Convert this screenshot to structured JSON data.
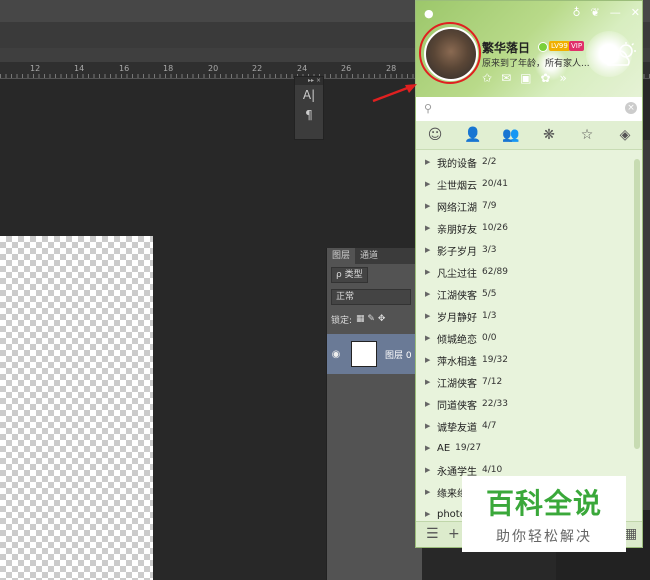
{
  "ruler": {
    "ticks": [
      "12",
      "14",
      "16",
      "18",
      "20",
      "22",
      "24",
      "26",
      "28"
    ]
  },
  "tool_panel": {
    "header": "▸▸ ×",
    "tools": [
      "A|",
      "¶"
    ]
  },
  "layers_panel": {
    "tabs": [
      "图层",
      "通道"
    ],
    "filter_kind": "ρ 类型",
    "blend_mode": "正常",
    "lock_label": "锁定:",
    "layer_name": "图层 0"
  },
  "qq": {
    "nickname": "繁华落日",
    "signature": "原来到了年龄，所有家人...",
    "level_badge": "LV99",
    "vip_badge": "VIP",
    "window_buttons": [
      "♁",
      "❦",
      "—",
      "✕"
    ],
    "header_icons": [
      "✩",
      "✉",
      "▣",
      "✿",
      "»"
    ],
    "search_placeholder": "",
    "tabs": [
      "☺",
      "👤",
      "👥",
      "❋",
      "☆",
      "◈"
    ],
    "groups": [
      {
        "name": "我的设备",
        "count": "2/2"
      },
      {
        "name": "尘世烟云",
        "count": "20/41"
      },
      {
        "name": "网络江湖",
        "count": "7/9"
      },
      {
        "name": "亲朋好友",
        "count": "10/26"
      },
      {
        "name": "影子岁月",
        "count": "3/3"
      },
      {
        "name": "凡尘过往",
        "count": "62/89"
      },
      {
        "name": "江湖侠客",
        "count": "5/5"
      },
      {
        "name": "岁月静好",
        "count": "1/3"
      },
      {
        "name": "倾城绝恋",
        "count": "0/0"
      },
      {
        "name": "萍水相逢",
        "count": "19/32"
      },
      {
        "name": "江湖侠客",
        "count": "7/12"
      },
      {
        "name": "同道侠客",
        "count": "22/33"
      },
      {
        "name": "诚挚友道",
        "count": "4/7"
      },
      {
        "name": "AE",
        "count": "19/27"
      },
      {
        "name": "永通学生",
        "count": "4/10"
      },
      {
        "name": "缘来缘",
        "count": ""
      },
      {
        "name": "photo",
        "count": ""
      }
    ],
    "bottom_buttons": [
      "☰",
      "+",
      "▦"
    ]
  },
  "watermark": {
    "title": "百科全说",
    "subtitle": "助你轻松解决"
  },
  "colors": {
    "qq_green": "#4a8a2a",
    "annotation_red": "#e02020",
    "ps_bg": "#282828"
  }
}
